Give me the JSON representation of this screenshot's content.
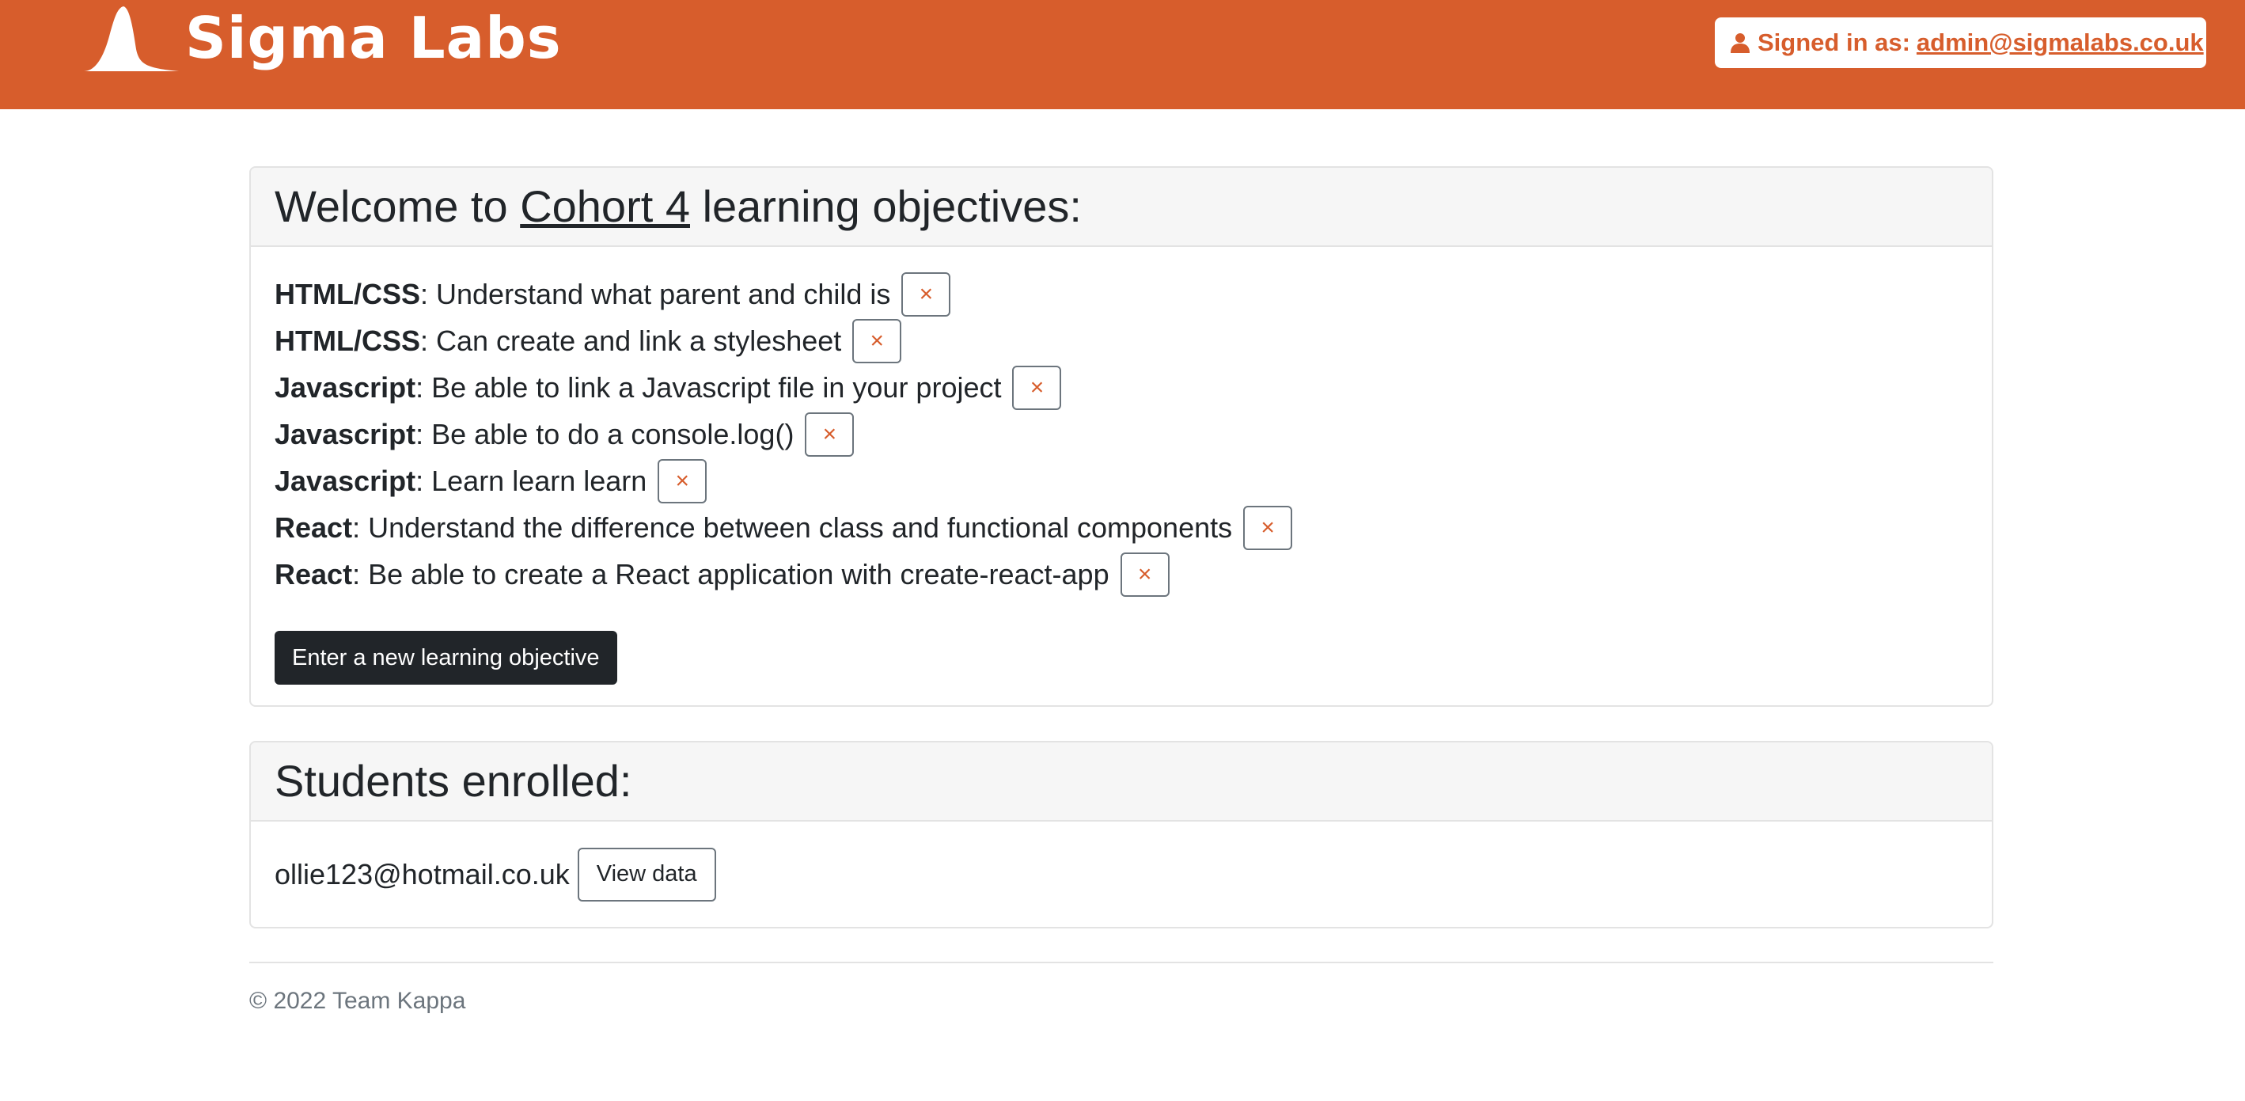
{
  "brand": {
    "name": "Sigma Labs",
    "logo_icon": "sigma-labs-logo-icon"
  },
  "user_menu": {
    "label": "Signed in as:",
    "email": "admin@sigmalabs.co.uk",
    "icon": "person-icon",
    "caret_icon": "caret-down-icon"
  },
  "objectives": {
    "title_prefix": "Welcome to",
    "cohort": "Cohort 4",
    "title_suffix": "learning objectives:",
    "items": [
      {
        "topic": "HTML/CSS",
        "text": ": Understand what parent and child is",
        "remove": "×"
      },
      {
        "topic": "HTML/CSS",
        "text": ": Can create and link a stylesheet",
        "remove": "×"
      },
      {
        "topic": "Javascript",
        "text": ": Be able to link a Javascript file in your project",
        "remove": "×"
      },
      {
        "topic": "Javascript",
        "text": ": Be able to do a console.log()",
        "remove": "×"
      },
      {
        "topic": "Javascript",
        "text": ": Learn learn learn",
        "remove": "×"
      },
      {
        "topic": "React",
        "text": ": Understand the difference between class and functional components",
        "remove": "×"
      },
      {
        "topic": "React",
        "text": ": Be able to create a React application with create-react-app",
        "remove": "×"
      }
    ],
    "new_button": "Enter a new learning objective"
  },
  "students": {
    "title": "Students enrolled:",
    "items": [
      {
        "email": "ollie123@hotmail.co.uk",
        "button": "View data"
      }
    ]
  },
  "footer": {
    "text": "© 2022 Team Kappa"
  },
  "colors": {
    "brand": "#d75d2c",
    "dark_button": "#212529",
    "card_header": "#f6f6f6"
  }
}
